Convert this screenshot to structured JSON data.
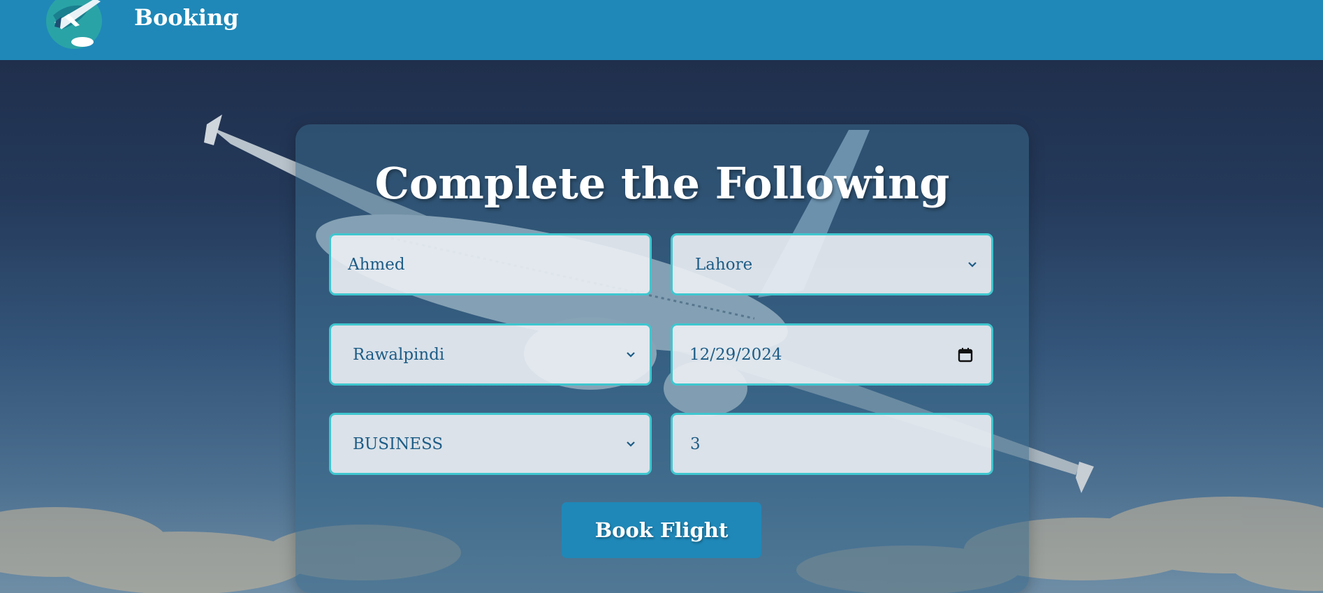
{
  "header": {
    "brand": "Booking",
    "logo_icon": "airplane-globe-icon"
  },
  "form": {
    "title": "Complete the Following",
    "name_value": "Ahmed",
    "from_value": "Lahore",
    "to_value": "Rawalpindi",
    "date_value": "12/29/2024",
    "class_value": "BUSINESS",
    "passengers_value": "3",
    "submit_label": "Book Flight"
  },
  "colors": {
    "header_bg": "#1f88b8",
    "field_border": "#3fc6cf",
    "field_text": "#1d5c86",
    "button_bg": "#1f88b8"
  }
}
